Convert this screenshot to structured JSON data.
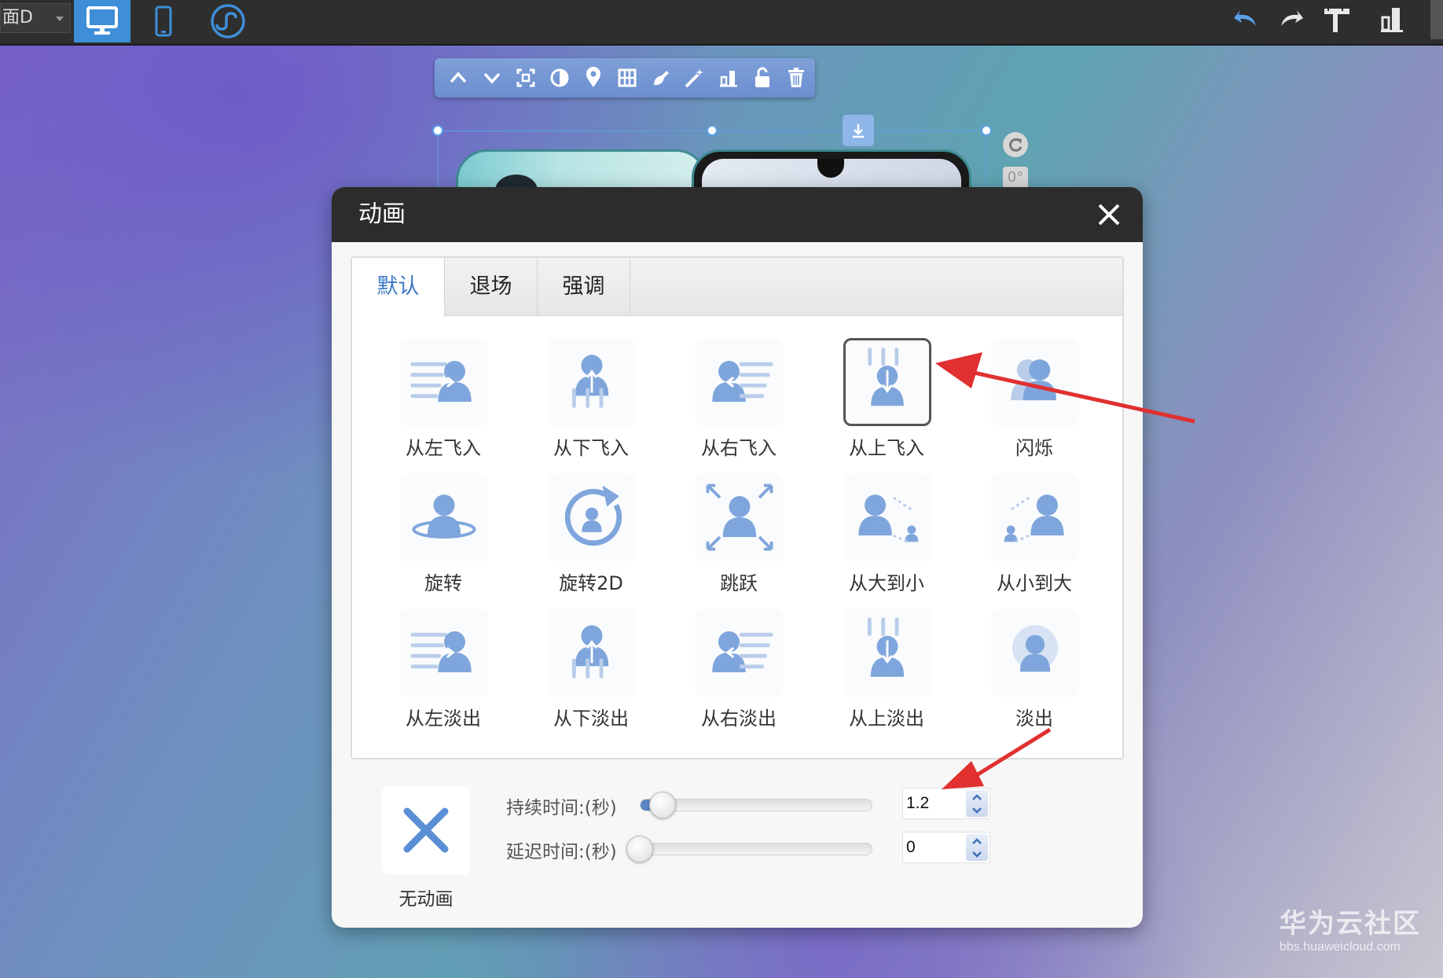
{
  "topbar": {
    "dropdown_text": "面D",
    "buttons": [
      {
        "name": "desktop-view",
        "icon": "monitor-icon",
        "active": true
      },
      {
        "name": "mobile-view",
        "icon": "phone-icon"
      },
      {
        "name": "mini-program",
        "icon": "mini-program-icon"
      }
    ],
    "right_tools": [
      "undo-icon",
      "redo-icon",
      "ruler-icon",
      "chart-icon"
    ],
    "accent": "#3e8ed8"
  },
  "float_toolbar": {
    "tools": [
      "move-up-icon",
      "move-down-icon",
      "crop-icon",
      "contrast-icon",
      "pin-icon",
      "grid-icon",
      "paint-icon",
      "magic-wand-icon",
      "align-icon",
      "unlock-icon",
      "trash-icon"
    ]
  },
  "selection": {
    "angle": "0°"
  },
  "dialog": {
    "title": "动画",
    "tabs": [
      "默认",
      "退场",
      "强调"
    ],
    "active_tab": "默认",
    "tab_accent": "#3a78c4",
    "icon_color": "#7fa6dc",
    "animations": [
      {
        "label": "从左飞入",
        "icon": "fly-in-left-icon"
      },
      {
        "label": "从下飞入",
        "icon": "fly-in-bottom-icon"
      },
      {
        "label": "从右飞入",
        "icon": "fly-in-right-icon"
      },
      {
        "label": "从上飞入",
        "icon": "fly-in-top-icon",
        "selected": true
      },
      {
        "label": "闪烁",
        "icon": "flash-icon"
      },
      {
        "label": "旋转",
        "icon": "rotate-icon"
      },
      {
        "label": "旋转2D",
        "icon": "rotate-2d-icon"
      },
      {
        "label": "跳跃",
        "icon": "jump-icon"
      },
      {
        "label": "从大到小",
        "icon": "shrink-icon"
      },
      {
        "label": "从小到大",
        "icon": "grow-icon"
      },
      {
        "label": "从左淡出",
        "icon": "fade-out-left-icon"
      },
      {
        "label": "从下淡出",
        "icon": "fade-out-bottom-icon"
      },
      {
        "label": "从右淡出",
        "icon": "fade-out-right-icon"
      },
      {
        "label": "从上淡出",
        "icon": "fade-out-top-icon"
      },
      {
        "label": "淡出",
        "icon": "fade-out-icon"
      }
    ],
    "no_animation_label": "无动画",
    "duration": {
      "label": "持续时间:(秒)",
      "value": "1.2",
      "level": 0.05
    },
    "delay": {
      "label": "延迟时间:(秒)",
      "value": "0",
      "level": 0.0
    }
  },
  "annotation_color": "#e03030",
  "watermark": {
    "main": "华为云社区",
    "sub": "bbs.huaweicloud.com"
  }
}
